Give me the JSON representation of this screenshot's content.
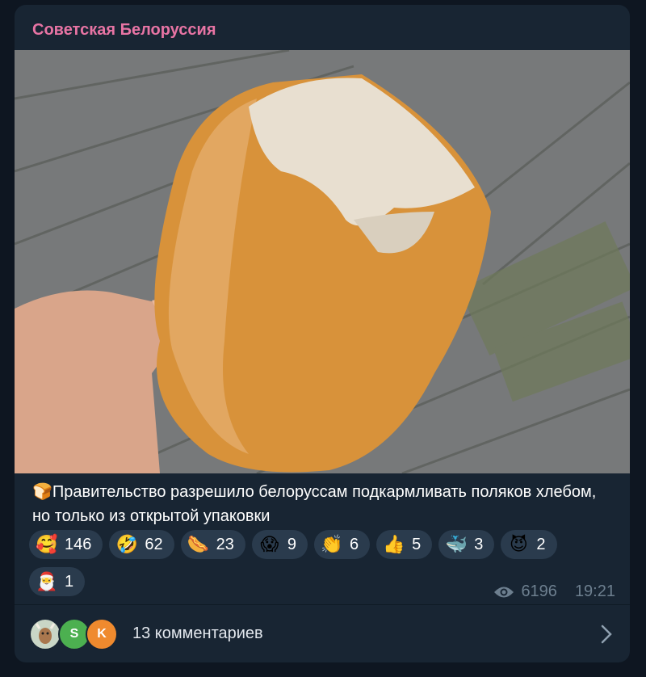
{
  "post": {
    "channel_name": "Советская Белоруссия",
    "caption": "Правительство разрешило белоруссам подкармливать поляков хлебом, но только из открытой упаковки",
    "caption_emoji": "🍞",
    "reactions": [
      {
        "emoji": "🥰",
        "count": "146"
      },
      {
        "emoji": "🤣",
        "count": "62"
      },
      {
        "emoji": "🌭",
        "count": "23"
      },
      {
        "emoji": "😱",
        "count": "9"
      },
      {
        "emoji": "👏",
        "count": "6"
      },
      {
        "emoji": "👍",
        "count": "5"
      },
      {
        "emoji": "🐳",
        "count": "3"
      },
      {
        "emoji": "😈",
        "count": "2"
      },
      {
        "emoji": "🎅",
        "count": "1"
      }
    ],
    "views": "6196",
    "time": "19:21",
    "comments": {
      "avatars": [
        "",
        "S",
        "K"
      ],
      "label": "13 комментариев"
    }
  },
  "icons": {
    "views": "eye-icon",
    "comments_chevron": "chevron-right-icon"
  },
  "colors": {
    "background": "#0e1621",
    "card": "#182533",
    "channel_name": "#e774a4",
    "reaction_bg": "#2a3b4d",
    "meta_text": "#6d7f8f"
  }
}
